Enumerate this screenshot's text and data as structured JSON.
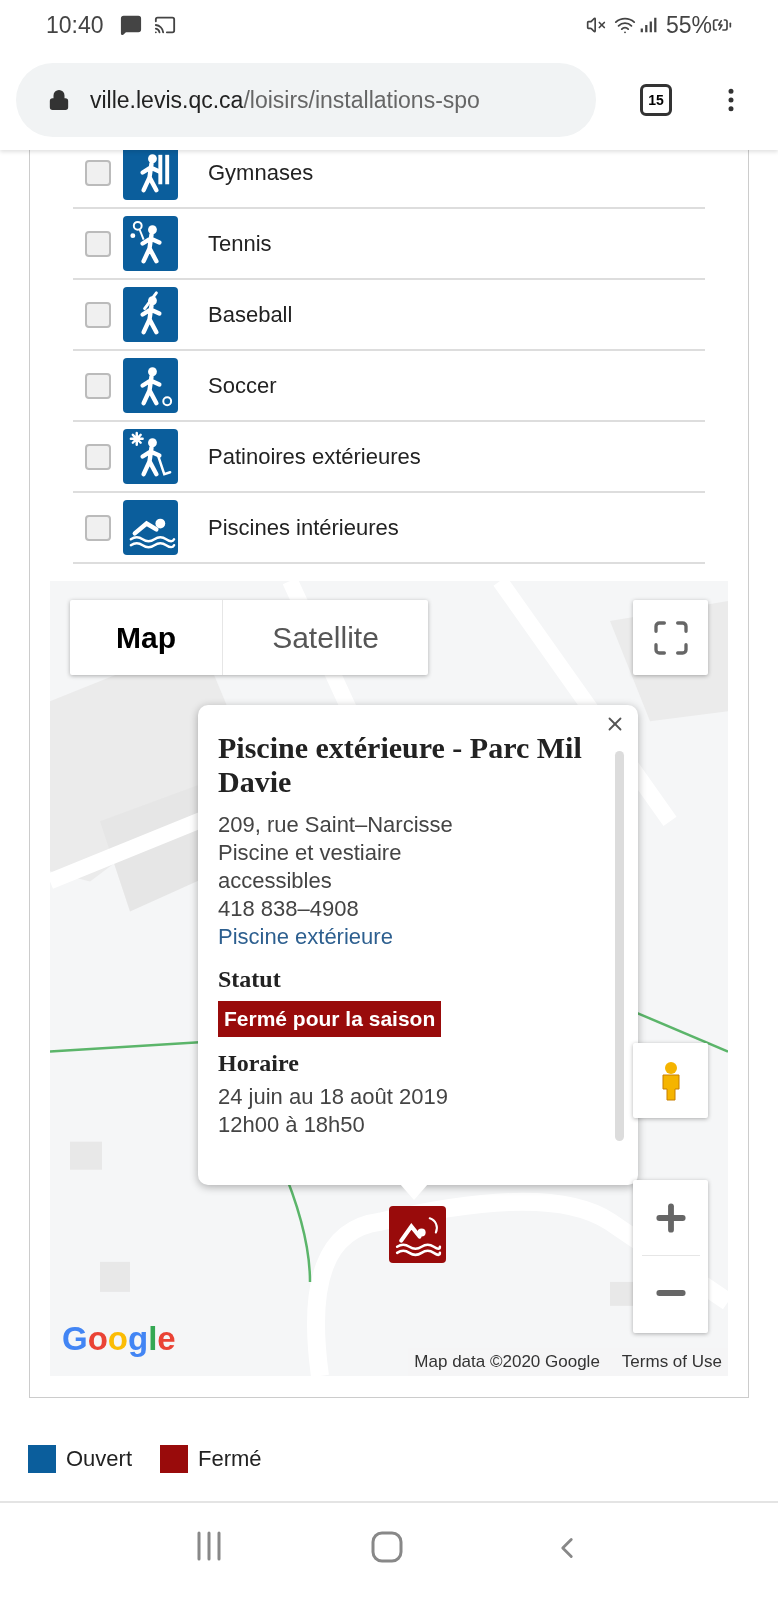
{
  "status_bar": {
    "time": "10:40",
    "battery": "55%"
  },
  "browser": {
    "url_host": "ville.levis.qc.ca",
    "url_path": "/loisirs/installations-spo",
    "tab_count": "15"
  },
  "facilities": [
    {
      "label": "Gymnases",
      "checked": false,
      "kind": "gym"
    },
    {
      "label": "Tennis",
      "checked": false,
      "kind": "tennis"
    },
    {
      "label": "Baseball",
      "checked": false,
      "kind": "baseball"
    },
    {
      "label": "Soccer",
      "checked": false,
      "kind": "soccer"
    },
    {
      "label": "Patinoires extérieures",
      "checked": false,
      "kind": "skating"
    },
    {
      "label": "Piscines intérieures",
      "checked": false,
      "kind": "swimming"
    }
  ],
  "map": {
    "map_types": [
      {
        "label": "Map",
        "selected": true
      },
      {
        "label": "Satellite",
        "selected": false
      }
    ],
    "popup": {
      "title": "Piscine extérieure - Parc Mil Davie",
      "lines": [
        "209, rue Saint–Narcisse",
        "Piscine et vestiaire accessibles",
        "418 838–4908"
      ],
      "link": "Piscine extérieure",
      "status_heading": "Statut",
      "status": {
        "label": "Fermé pour la saison",
        "kind": "closed"
      },
      "hours_heading": "Horaire",
      "hours": [
        "24 juin au 18 août 2019",
        "12h00 à 18h50"
      ]
    },
    "marker": {
      "kind": "closed"
    },
    "logo": "Google",
    "attribution": "Map data ©2020 Google",
    "terms": "Terms of Use"
  },
  "legend": [
    {
      "label": "Ouvert",
      "color": "#0b5e9c"
    },
    {
      "label": "Fermé",
      "color": "#990b0b"
    }
  ]
}
